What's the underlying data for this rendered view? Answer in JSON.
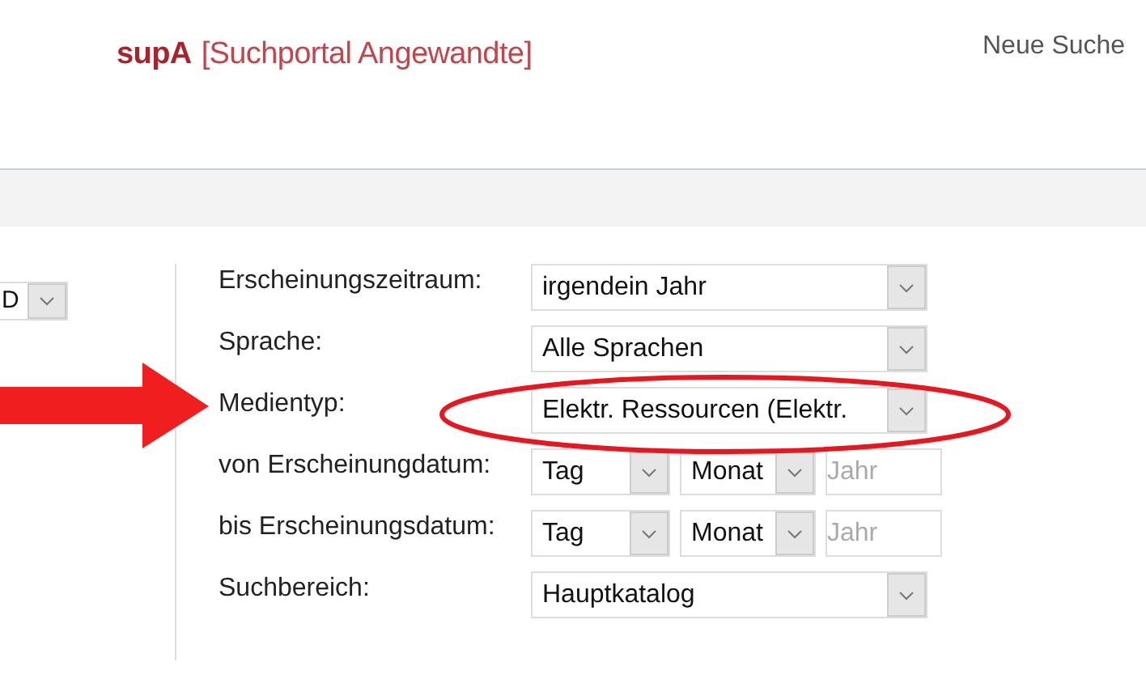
{
  "header": {
    "logo_short": "supA",
    "logo_long": "[Suchportal Angewandte]",
    "nav_link": "Neue Suche"
  },
  "left_select": {
    "value": "D"
  },
  "fields": [
    {
      "label": "Erscheinungszeitraum:",
      "kind": "select",
      "value": "irgendein Jahr"
    },
    {
      "label": "Sprache:",
      "kind": "select",
      "value": "Alle Sprachen"
    },
    {
      "label": "Medientyp:",
      "kind": "select",
      "value": "Elektr. Ressourcen (Elektr."
    },
    {
      "label": "von Erscheinungdatum:",
      "kind": "date",
      "day": "Tag",
      "month": "Monat",
      "year_placeholder": "Jahr"
    },
    {
      "label": "bis Erscheinungsdatum:",
      "kind": "date",
      "day": "Tag",
      "month": "Monat",
      "year_placeholder": "Jahr"
    },
    {
      "label": "Suchbereich:",
      "kind": "select",
      "value": "Hauptkatalog"
    }
  ],
  "annotations": {
    "arrow_shown": true,
    "ellipse_shown": true
  }
}
